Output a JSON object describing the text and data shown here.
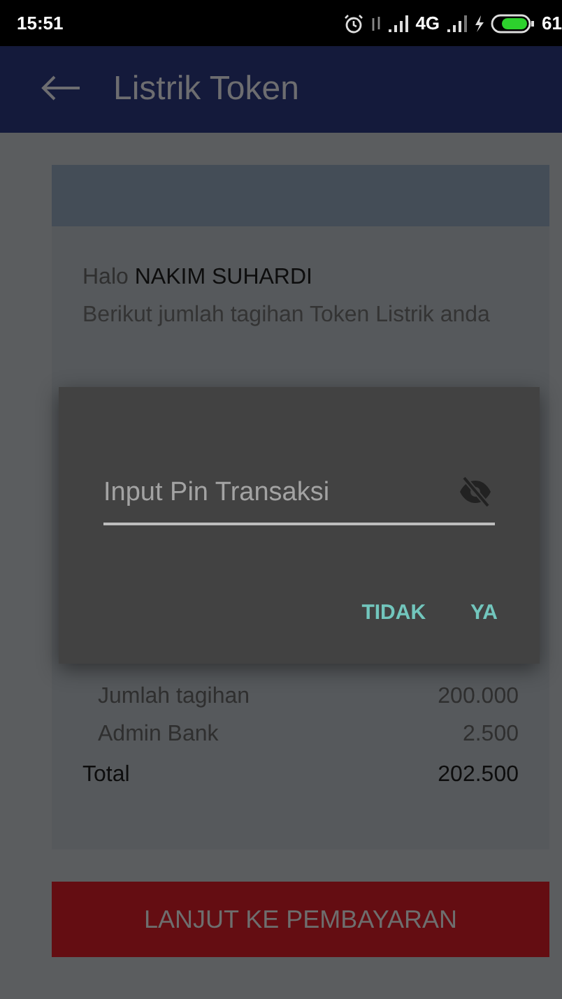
{
  "status_bar": {
    "time": "15:51",
    "network": "4G",
    "battery": "61"
  },
  "app_bar": {
    "title": "Listrik Token"
  },
  "greeting": {
    "salutation": "Halo",
    "name": "NAKIM SUHARDI",
    "message": "Berikut jumlah tagihan Token Listrik anda"
  },
  "bill": {
    "rows": [
      {
        "label": "Jumlah tagihan",
        "value": "200.000",
        "kind": "item"
      },
      {
        "label": "Admin Bank",
        "value": "2.500",
        "kind": "item"
      },
      {
        "label": "Total",
        "value": "202.500",
        "kind": "total"
      }
    ]
  },
  "pay_button": "LANJUT KE PEMBAYARAN",
  "dialog": {
    "field": {
      "placeholder": "Input Pin Transaksi",
      "masked": true
    },
    "buttons": [
      "TIDAK",
      "YA"
    ]
  }
}
